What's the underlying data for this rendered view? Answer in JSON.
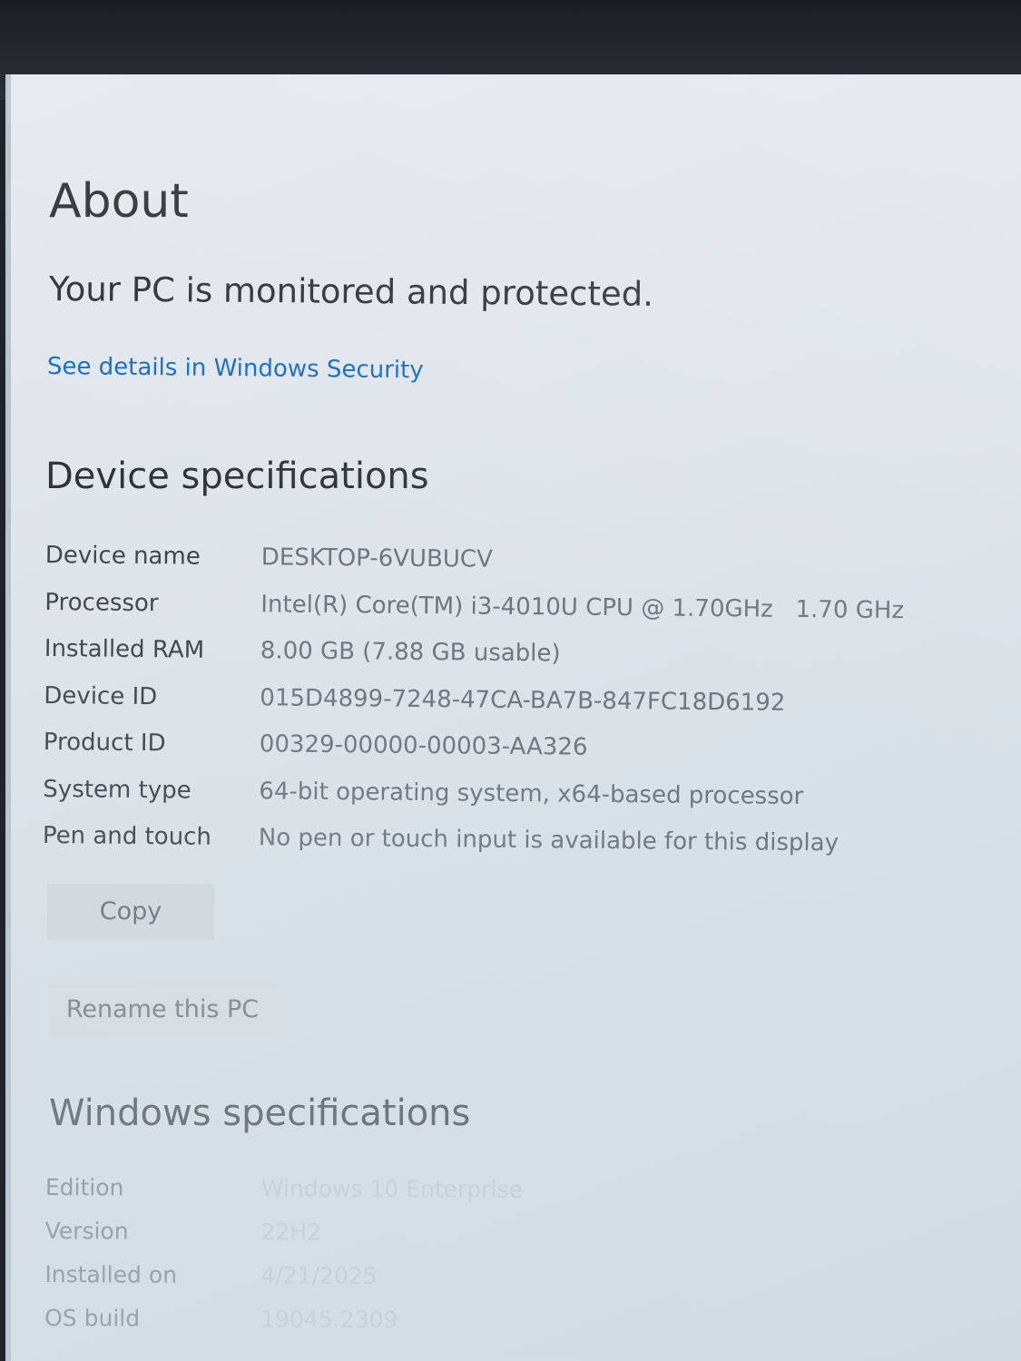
{
  "page": {
    "title": "About"
  },
  "security": {
    "status": "Your PC is monitored and protected.",
    "link_label": "See details in Windows Security"
  },
  "device_specs": {
    "heading": "Device specifications",
    "rows": [
      {
        "label": "Device name",
        "value": "DESKTOP-6VUBUCV"
      },
      {
        "label": "Processor",
        "value": "Intel(R) Core(TM) i3-4010U CPU @ 1.70GHz   1.70 GHz"
      },
      {
        "label": "Installed RAM",
        "value": "8.00 GB (7.88 GB usable)"
      },
      {
        "label": "Device ID",
        "value": "015D4899-7248-47CA-BA7B-847FC18D6192"
      },
      {
        "label": "Product ID",
        "value": "00329-00000-00003-AA326"
      },
      {
        "label": "System type",
        "value": "64-bit operating system, x64-based processor"
      },
      {
        "label": "Pen and touch",
        "value": "No pen or touch input is available for this display"
      }
    ],
    "copy_label": "Copy",
    "rename_label": "Rename this PC"
  },
  "windows_specs": {
    "heading": "Windows specifications",
    "rows": [
      {
        "label": "Edition",
        "value": "Windows 10 Enterprise"
      },
      {
        "label": "Version",
        "value": "22H2"
      },
      {
        "label": "Installed on",
        "value": "4/21/2025"
      },
      {
        "label": "OS build",
        "value": "19045.2309"
      }
    ]
  },
  "colors": {
    "link": "#1a6bb8",
    "background": "#dde4ea",
    "text": "#2c3137"
  }
}
